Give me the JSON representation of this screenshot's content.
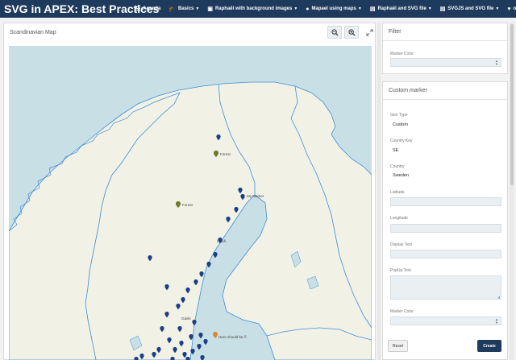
{
  "app": {
    "title": "SVG in APEX: Best Practices"
  },
  "nav": {
    "items": [
      {
        "label": "Agenda",
        "icon": "list-icon",
        "has_caret": false
      },
      {
        "label": "Basics",
        "icon": "graduation-cap-icon",
        "has_caret": true
      },
      {
        "label": "Raphaël with background images",
        "icon": "image-icon",
        "has_caret": true
      },
      {
        "label": "Mapael using maps",
        "icon": "map-marker-icon",
        "has_caret": true
      },
      {
        "label": "Raphaël and SVG file",
        "icon": "file-icon",
        "has_caret": true
      },
      {
        "label": "SVGJS and SVG file",
        "icon": "file-icon",
        "has_caret": true
      },
      {
        "label": "o",
        "icon": "heart-icon",
        "has_caret": false
      }
    ]
  },
  "map": {
    "title": "Scandinavian Map",
    "labels": {
      "forest_north": "Forest",
      "forest_mid": "Forest",
      "my_marker": "My Marker",
      "here_should_be": "Here should be Å",
      "oulu_label": "Luleå",
      "lower_label": "Gävle"
    }
  },
  "filter": {
    "title": "Filter",
    "marker_color_label": "Marker Color",
    "marker_color_value": ""
  },
  "custom_marker": {
    "title": "Custom marker",
    "geo_type_label": "Geo Type",
    "geo_type_value": "Custom",
    "country_key_label": "Country Key",
    "country_key_value": "SE",
    "country_label": "Country",
    "country_value": "Sweden",
    "latitude_label": "Latitude",
    "longitude_label": "Longitude",
    "display_text_label": "Display Text",
    "popup_text_label": "PopUp Text",
    "marker_color_label": "Marker Color",
    "reset_label": "Reset",
    "create_label": "Create"
  },
  "colors": {
    "nav_bg": "#1e3a5c",
    "sea": "#c9dfe6",
    "land": "#f1f1e6",
    "border_line": "#3d8ed8",
    "marker_blue": "#1b3f86",
    "marker_green": "#6b7a2a",
    "marker_orange": "#d98a2b"
  }
}
